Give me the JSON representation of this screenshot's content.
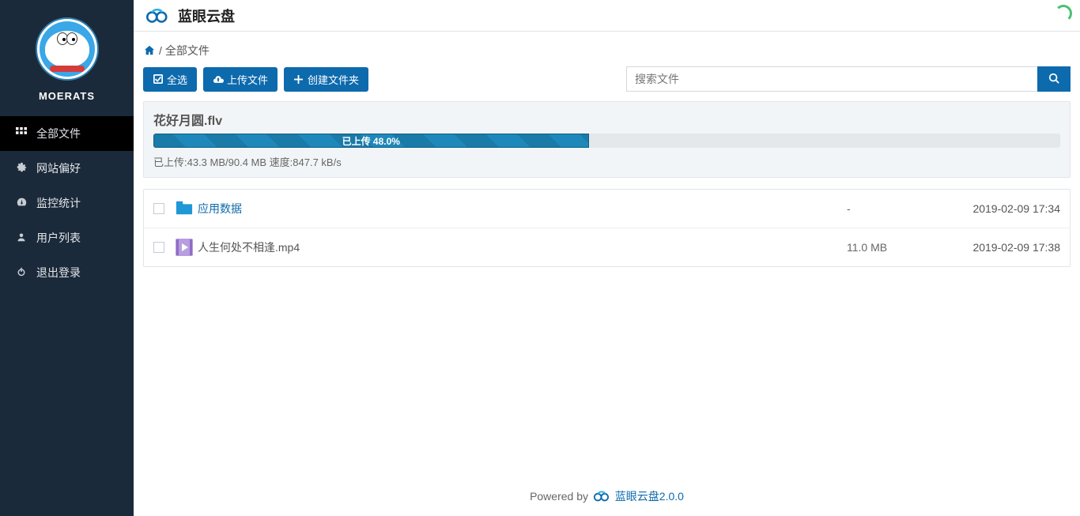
{
  "brand": {
    "title": "蓝眼云盘"
  },
  "user": {
    "name": "MOERATS"
  },
  "nav": {
    "items": [
      {
        "label": "全部文件"
      },
      {
        "label": "网站偏好"
      },
      {
        "label": "监控统计"
      },
      {
        "label": "用户列表"
      },
      {
        "label": "退出登录"
      }
    ]
  },
  "breadcrumb": {
    "sep": "/",
    "root": "全部文件"
  },
  "toolbar": {
    "select_all": "全选",
    "upload": "上传文件",
    "new_folder": "创建文件夹"
  },
  "search": {
    "placeholder": "搜索文件"
  },
  "upload": {
    "filename": "花好月圆.flv",
    "progress_label": "已上传 48.0%",
    "progress_percent": 48,
    "status": "已上传:43.3 MB/90.4 MB 速度:847.7 kB/s"
  },
  "files": [
    {
      "name": "应用数据",
      "size": "-",
      "date": "2019-02-09 17:34"
    },
    {
      "name": "人生何处不相逢.mp4",
      "size": "11.0 MB",
      "date": "2019-02-09 17:38"
    }
  ],
  "footer": {
    "prefix": "Powered by ",
    "link": "蓝眼云盘2.0.0"
  },
  "colors": {
    "primary": "#0d6aad",
    "sidebar": "#1b2a3a"
  }
}
